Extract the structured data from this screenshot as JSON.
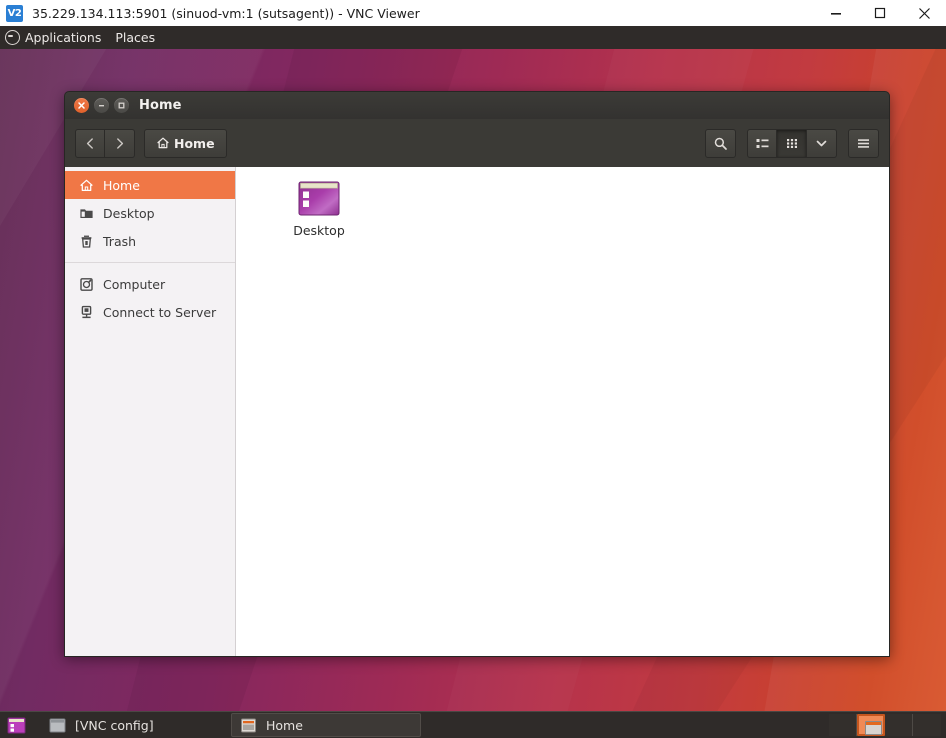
{
  "vnc_window": {
    "logo_text": "V2",
    "title": "35.229.134.113:5901 (sinuod-vm:1 (sutsagent)) - VNC Viewer",
    "controls": {
      "minimize": "minimize-icon",
      "maximize": "maximize-icon",
      "close": "close-icon"
    }
  },
  "top_panel": {
    "applications_label": "Applications",
    "places_label": "Places",
    "menu_icon": "ubuntu-circle-icon",
    "background_color": "#2f2b29"
  },
  "file_manager": {
    "window_title": "Home",
    "titlebar_buttons": {
      "close": "close-icon",
      "minimize": "minimize-icon",
      "maximize": "maximize-icon"
    },
    "toolbar": {
      "back_label": "back-icon",
      "forward_label": "forward-icon",
      "path_label": "Home",
      "path_icon": "home-icon",
      "search_icon": "search-icon",
      "view_list_icon": "list-view-icon",
      "view_grid_icon": "grid-view-icon",
      "view_options_icon": "chevron-down-icon",
      "menu_icon": "hamburger-menu-icon"
    },
    "sidebar": {
      "items": [
        {
          "label": "Home",
          "icon": "home-icon",
          "selected": true
        },
        {
          "label": "Desktop",
          "icon": "folder-icon",
          "selected": false
        },
        {
          "label": "Trash",
          "icon": "trash-icon",
          "selected": false
        },
        {
          "label": "Computer",
          "icon": "computer-icon",
          "selected": false
        },
        {
          "label": "Connect to Server",
          "icon": "server-icon",
          "selected": false
        }
      ],
      "selected_color": "#f07746",
      "background_color": "#f4f2f4"
    },
    "files": [
      {
        "name": "Desktop",
        "icon": "desktop-folder-icon"
      }
    ]
  },
  "bottom_panel": {
    "show_desktop_icon": "show-desktop-icon",
    "tasks": [
      {
        "label": "[VNC config]",
        "icon": "window-icon",
        "active": false
      },
      {
        "label": "Home",
        "icon": "file-manager-icon",
        "active": true
      }
    ],
    "workspaces": [
      {
        "active": false
      },
      {
        "active": true
      },
      {
        "active": false
      },
      {
        "active": false
      }
    ]
  },
  "wallpaper": {
    "gradient_start": "#5e2750",
    "gradient_end": "#d8542a"
  }
}
